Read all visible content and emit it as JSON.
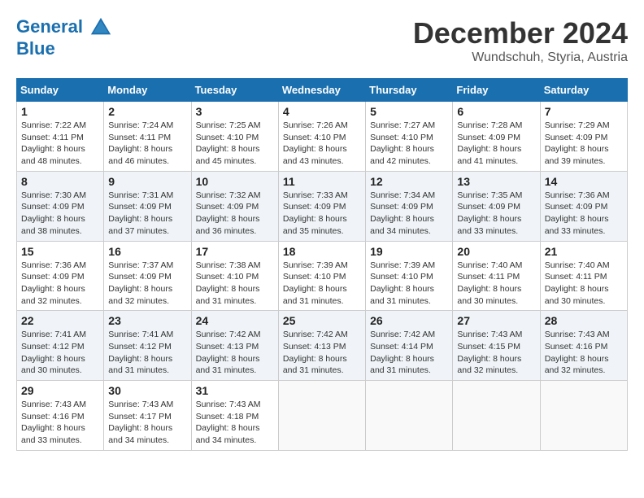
{
  "header": {
    "logo_line1": "General",
    "logo_line2": "Blue",
    "month": "December 2024",
    "location": "Wundschuh, Styria, Austria"
  },
  "weekdays": [
    "Sunday",
    "Monday",
    "Tuesday",
    "Wednesday",
    "Thursday",
    "Friday",
    "Saturday"
  ],
  "weeks": [
    [
      {
        "day": "1",
        "sunrise": "7:22 AM",
        "sunset": "4:11 PM",
        "daylight": "8 hours and 48 minutes."
      },
      {
        "day": "2",
        "sunrise": "7:24 AM",
        "sunset": "4:11 PM",
        "daylight": "8 hours and 46 minutes."
      },
      {
        "day": "3",
        "sunrise": "7:25 AM",
        "sunset": "4:10 PM",
        "daylight": "8 hours and 45 minutes."
      },
      {
        "day": "4",
        "sunrise": "7:26 AM",
        "sunset": "4:10 PM",
        "daylight": "8 hours and 43 minutes."
      },
      {
        "day": "5",
        "sunrise": "7:27 AM",
        "sunset": "4:10 PM",
        "daylight": "8 hours and 42 minutes."
      },
      {
        "day": "6",
        "sunrise": "7:28 AM",
        "sunset": "4:09 PM",
        "daylight": "8 hours and 41 minutes."
      },
      {
        "day": "7",
        "sunrise": "7:29 AM",
        "sunset": "4:09 PM",
        "daylight": "8 hours and 39 minutes."
      }
    ],
    [
      {
        "day": "8",
        "sunrise": "7:30 AM",
        "sunset": "4:09 PM",
        "daylight": "8 hours and 38 minutes."
      },
      {
        "day": "9",
        "sunrise": "7:31 AM",
        "sunset": "4:09 PM",
        "daylight": "8 hours and 37 minutes."
      },
      {
        "day": "10",
        "sunrise": "7:32 AM",
        "sunset": "4:09 PM",
        "daylight": "8 hours and 36 minutes."
      },
      {
        "day": "11",
        "sunrise": "7:33 AM",
        "sunset": "4:09 PM",
        "daylight": "8 hours and 35 minutes."
      },
      {
        "day": "12",
        "sunrise": "7:34 AM",
        "sunset": "4:09 PM",
        "daylight": "8 hours and 34 minutes."
      },
      {
        "day": "13",
        "sunrise": "7:35 AM",
        "sunset": "4:09 PM",
        "daylight": "8 hours and 33 minutes."
      },
      {
        "day": "14",
        "sunrise": "7:36 AM",
        "sunset": "4:09 PM",
        "daylight": "8 hours and 33 minutes."
      }
    ],
    [
      {
        "day": "15",
        "sunrise": "7:36 AM",
        "sunset": "4:09 PM",
        "daylight": "8 hours and 32 minutes."
      },
      {
        "day": "16",
        "sunrise": "7:37 AM",
        "sunset": "4:09 PM",
        "daylight": "8 hours and 32 minutes."
      },
      {
        "day": "17",
        "sunrise": "7:38 AM",
        "sunset": "4:10 PM",
        "daylight": "8 hours and 31 minutes."
      },
      {
        "day": "18",
        "sunrise": "7:39 AM",
        "sunset": "4:10 PM",
        "daylight": "8 hours and 31 minutes."
      },
      {
        "day": "19",
        "sunrise": "7:39 AM",
        "sunset": "4:10 PM",
        "daylight": "8 hours and 31 minutes."
      },
      {
        "day": "20",
        "sunrise": "7:40 AM",
        "sunset": "4:11 PM",
        "daylight": "8 hours and 30 minutes."
      },
      {
        "day": "21",
        "sunrise": "7:40 AM",
        "sunset": "4:11 PM",
        "daylight": "8 hours and 30 minutes."
      }
    ],
    [
      {
        "day": "22",
        "sunrise": "7:41 AM",
        "sunset": "4:12 PM",
        "daylight": "8 hours and 30 minutes."
      },
      {
        "day": "23",
        "sunrise": "7:41 AM",
        "sunset": "4:12 PM",
        "daylight": "8 hours and 31 minutes."
      },
      {
        "day": "24",
        "sunrise": "7:42 AM",
        "sunset": "4:13 PM",
        "daylight": "8 hours and 31 minutes."
      },
      {
        "day": "25",
        "sunrise": "7:42 AM",
        "sunset": "4:13 PM",
        "daylight": "8 hours and 31 minutes."
      },
      {
        "day": "26",
        "sunrise": "7:42 AM",
        "sunset": "4:14 PM",
        "daylight": "8 hours and 31 minutes."
      },
      {
        "day": "27",
        "sunrise": "7:43 AM",
        "sunset": "4:15 PM",
        "daylight": "8 hours and 32 minutes."
      },
      {
        "day": "28",
        "sunrise": "7:43 AM",
        "sunset": "4:16 PM",
        "daylight": "8 hours and 32 minutes."
      }
    ],
    [
      {
        "day": "29",
        "sunrise": "7:43 AM",
        "sunset": "4:16 PM",
        "daylight": "8 hours and 33 minutes."
      },
      {
        "day": "30",
        "sunrise": "7:43 AM",
        "sunset": "4:17 PM",
        "daylight": "8 hours and 34 minutes."
      },
      {
        "day": "31",
        "sunrise": "7:43 AM",
        "sunset": "4:18 PM",
        "daylight": "8 hours and 34 minutes."
      },
      null,
      null,
      null,
      null
    ]
  ]
}
